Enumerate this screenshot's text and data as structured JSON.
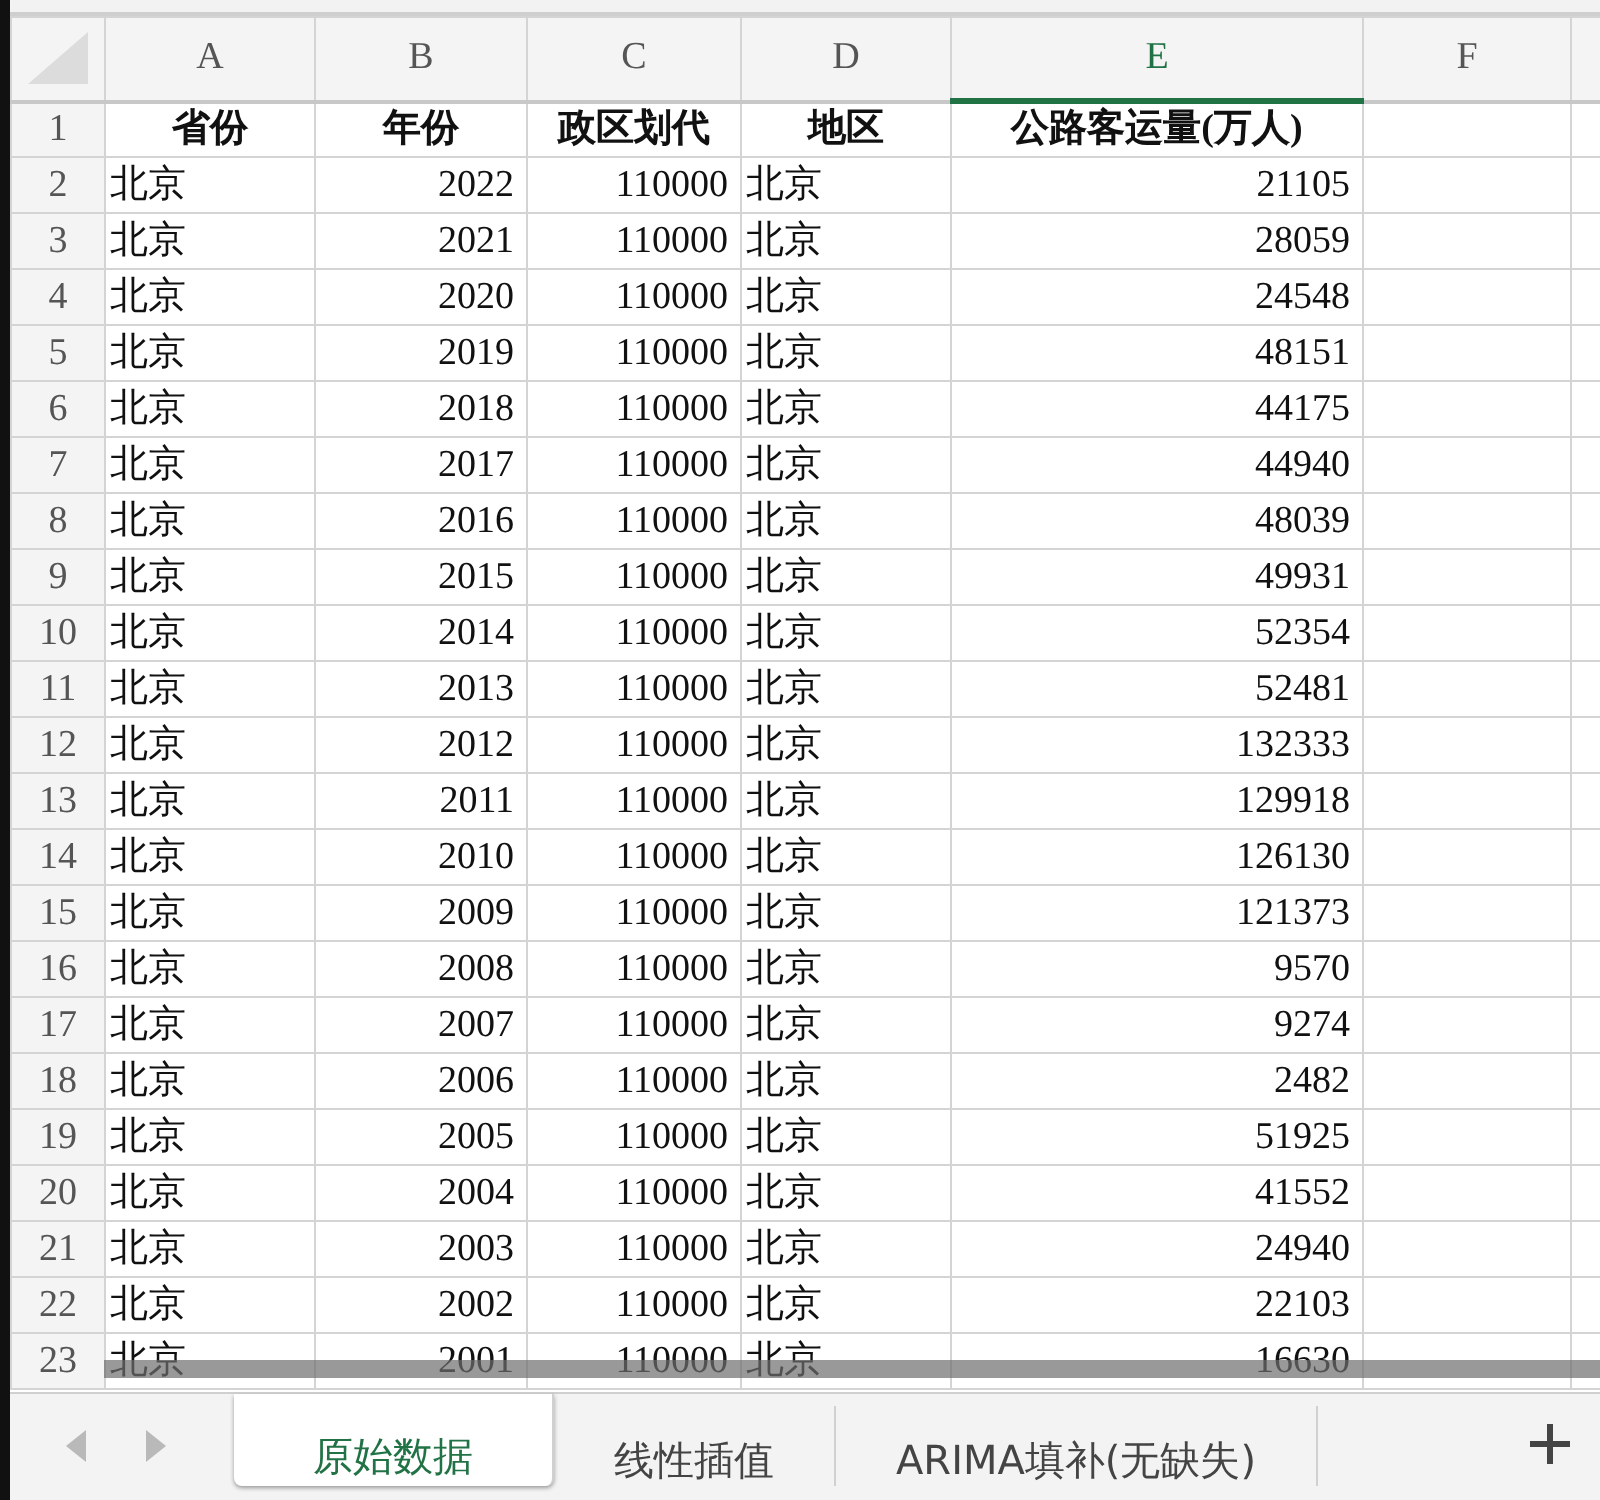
{
  "columns": [
    {
      "label": "A",
      "selected": false
    },
    {
      "label": "B",
      "selected": false
    },
    {
      "label": "C",
      "selected": false
    },
    {
      "label": "D",
      "selected": false
    },
    {
      "label": "E",
      "selected": true
    },
    {
      "label": "F",
      "selected": false
    }
  ],
  "rows": [
    {
      "number": "1",
      "kind": "header",
      "cells": [
        "省份",
        "年份",
        "政区划代",
        "地区",
        "公路客运量(万人)",
        ""
      ]
    },
    {
      "number": "2",
      "kind": "data",
      "cells": [
        "北京",
        "2022",
        "110000",
        "北京",
        "21105",
        ""
      ]
    },
    {
      "number": "3",
      "kind": "data",
      "cells": [
        "北京",
        "2021",
        "110000",
        "北京",
        "28059",
        ""
      ]
    },
    {
      "number": "4",
      "kind": "data",
      "cells": [
        "北京",
        "2020",
        "110000",
        "北京",
        "24548",
        ""
      ]
    },
    {
      "number": "5",
      "kind": "data",
      "cells": [
        "北京",
        "2019",
        "110000",
        "北京",
        "48151",
        ""
      ]
    },
    {
      "number": "6",
      "kind": "data",
      "cells": [
        "北京",
        "2018",
        "110000",
        "北京",
        "44175",
        ""
      ]
    },
    {
      "number": "7",
      "kind": "data",
      "cells": [
        "北京",
        "2017",
        "110000",
        "北京",
        "44940",
        ""
      ]
    },
    {
      "number": "8",
      "kind": "data",
      "cells": [
        "北京",
        "2016",
        "110000",
        "北京",
        "48039",
        ""
      ]
    },
    {
      "number": "9",
      "kind": "data",
      "cells": [
        "北京",
        "2015",
        "110000",
        "北京",
        "49931",
        ""
      ]
    },
    {
      "number": "10",
      "kind": "data",
      "cells": [
        "北京",
        "2014",
        "110000",
        "北京",
        "52354",
        ""
      ]
    },
    {
      "number": "11",
      "kind": "data",
      "cells": [
        "北京",
        "2013",
        "110000",
        "北京",
        "52481",
        ""
      ]
    },
    {
      "number": "12",
      "kind": "data",
      "cells": [
        "北京",
        "2012",
        "110000",
        "北京",
        "132333",
        ""
      ]
    },
    {
      "number": "13",
      "kind": "data",
      "cells": [
        "北京",
        "2011",
        "110000",
        "北京",
        "129918",
        ""
      ]
    },
    {
      "number": "14",
      "kind": "data",
      "cells": [
        "北京",
        "2010",
        "110000",
        "北京",
        "126130",
        ""
      ]
    },
    {
      "number": "15",
      "kind": "data",
      "cells": [
        "北京",
        "2009",
        "110000",
        "北京",
        "121373",
        ""
      ]
    },
    {
      "number": "16",
      "kind": "data",
      "cells": [
        "北京",
        "2008",
        "110000",
        "北京",
        "9570",
        ""
      ]
    },
    {
      "number": "17",
      "kind": "data",
      "cells": [
        "北京",
        "2007",
        "110000",
        "北京",
        "9274",
        ""
      ]
    },
    {
      "number": "18",
      "kind": "data",
      "cells": [
        "北京",
        "2006",
        "110000",
        "北京",
        "2482",
        ""
      ]
    },
    {
      "number": "19",
      "kind": "data",
      "cells": [
        "北京",
        "2005",
        "110000",
        "北京",
        "51925",
        ""
      ]
    },
    {
      "number": "20",
      "kind": "data",
      "cells": [
        "北京",
        "2004",
        "110000",
        "北京",
        "41552",
        ""
      ]
    },
    {
      "number": "21",
      "kind": "data",
      "cells": [
        "北京",
        "2003",
        "110000",
        "北京",
        "24940",
        ""
      ]
    },
    {
      "number": "22",
      "kind": "data",
      "cells": [
        "北京",
        "2002",
        "110000",
        "北京",
        "22103",
        ""
      ]
    },
    {
      "number": "23",
      "kind": "data",
      "cells": [
        "北京",
        "2001",
        "110000",
        "北京",
        "16630",
        ""
      ]
    }
  ],
  "sheet_tabs": [
    {
      "label": "原始数据",
      "selected": true
    },
    {
      "label": "线性插值",
      "selected": false
    },
    {
      "label": "ARIMA填补(无缺失)",
      "selected": false
    }
  ]
}
